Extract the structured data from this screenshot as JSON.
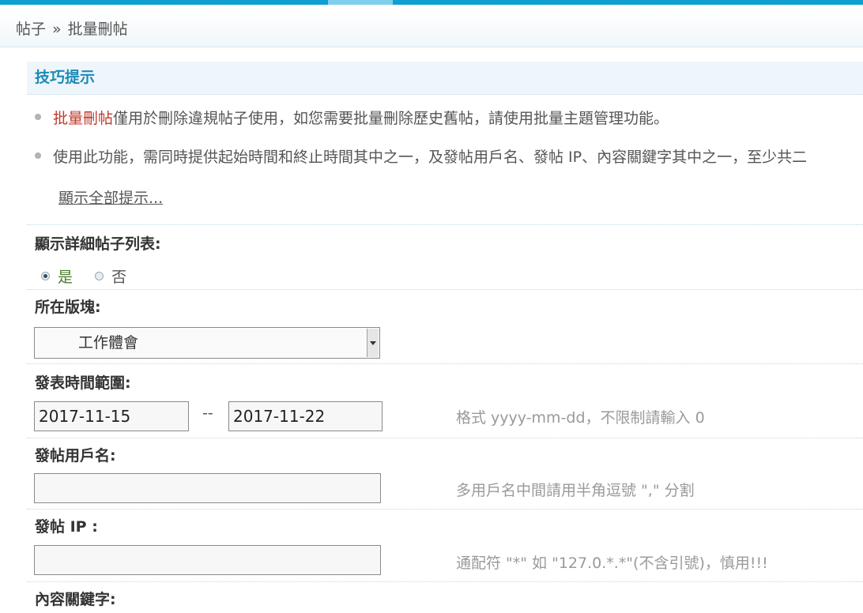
{
  "breadcrumb": {
    "root": "帖子",
    "separator": "»",
    "current": "批量刪帖"
  },
  "tips": {
    "title": "技巧提示",
    "items": [
      {
        "highlight": "批量刪帖",
        "text": "僅用於刪除違規帖子使用，如您需要批量刪除歷史舊帖，請使用批量主題管理功能。"
      },
      {
        "highlight": "",
        "text": "使用此功能，需同時提供起始時間和終止時間其中之一，及發帖用戶名、發帖 IP、內容關鍵字其中之一，至少共二"
      }
    ],
    "show_all": "顯示全部提示..."
  },
  "form": {
    "detail_list": {
      "label": "顯示詳細帖子列表:",
      "options": [
        "是",
        "否"
      ],
      "selected": "是"
    },
    "forum": {
      "label": "所在版塊:",
      "selected": "工作體會"
    },
    "time_range": {
      "label": "發表時間範圍:",
      "start": "2017-11-15",
      "separator": "--",
      "end": "2017-11-22",
      "hint": "格式 yyyy-mm-dd，不限制請輸入 0"
    },
    "username": {
      "label": "發帖用戶名:",
      "value": "",
      "hint": "多用戶名中間請用半角逗號 \",\" 分割"
    },
    "ip": {
      "label": "發帖 IP :",
      "value": "",
      "hint": "通配符 \"*\" 如 \"127.0.*.*\"(不含引號)，慎用!!!"
    },
    "keyword": {
      "label": "內容關鍵字:"
    }
  },
  "colors": {
    "accent": "#0f9fd0",
    "tips_title": "#1d8ab6",
    "highlight": "#c0392b",
    "hint": "#9a9a9a"
  }
}
